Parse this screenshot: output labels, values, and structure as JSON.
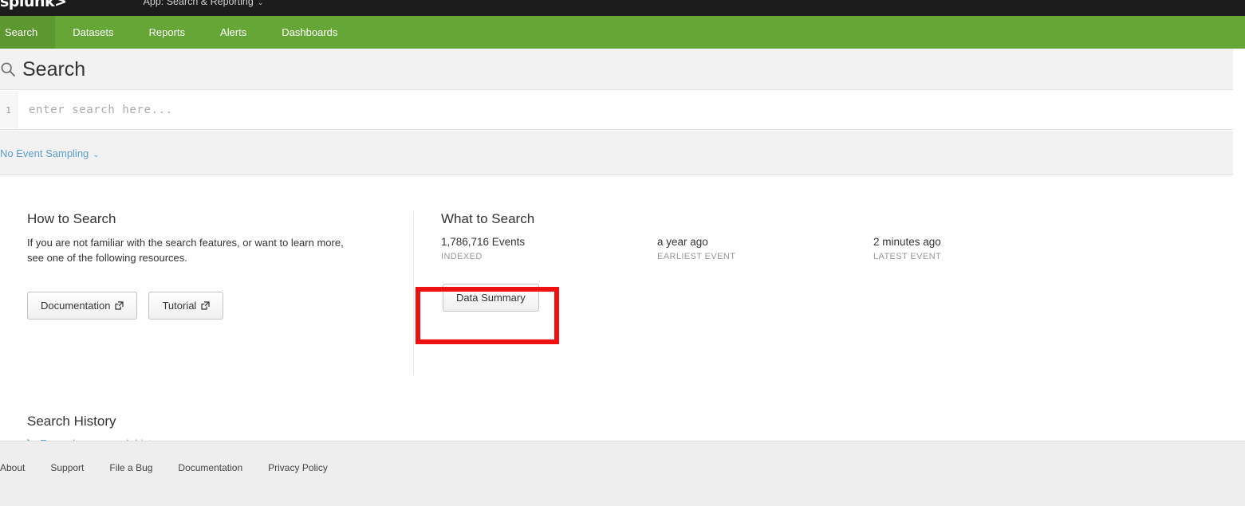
{
  "appbar": {
    "logo": "splunk>",
    "app_context": "App: Search & Reporting",
    "caret": "⌄"
  },
  "nav": {
    "items": [
      {
        "label": "Search",
        "active": true
      },
      {
        "label": "Datasets",
        "active": false
      },
      {
        "label": "Reports",
        "active": false
      },
      {
        "label": "Alerts",
        "active": false
      },
      {
        "label": "Dashboards",
        "active": false
      }
    ]
  },
  "page": {
    "title": "Search",
    "title_icon": "search-icon"
  },
  "search": {
    "line_number": "1",
    "value": "",
    "placeholder": "enter search here..."
  },
  "sampling": {
    "label": "No Event Sampling",
    "caret": "⌄"
  },
  "how_to_search": {
    "heading": "How to Search",
    "description": "If you are not familiar with the search features, or want to learn more, see one of the following resources.",
    "buttons": [
      {
        "label": "Documentation",
        "icon": "external-link-icon"
      },
      {
        "label": "Tutorial",
        "icon": "external-link-icon"
      }
    ]
  },
  "what_to_search": {
    "heading": "What to Search",
    "stats": [
      {
        "value": "1,786,716 Events",
        "label": "INDEXED"
      },
      {
        "value": "a year ago",
        "label": "EARLIEST EVENT"
      },
      {
        "value": "2 minutes ago",
        "label": "LATEST EVENT"
      }
    ],
    "data_summary_button": "Data Summary"
  },
  "search_history": {
    "heading": "Search History",
    "expand_label": "Expand your search history"
  },
  "footer": {
    "links": [
      "About",
      "Support",
      "File a Bug",
      "Documentation",
      "Privacy Policy"
    ]
  },
  "annotation": {
    "color": "#ee1111",
    "target": "data-summary-button"
  },
  "colors": {
    "nav_green": "#65a637",
    "nav_green_active": "#5c9730",
    "appbar_black": "#1c1c1c",
    "link_blue": "#5a9ece",
    "strip_gray": "#f2f2f2",
    "footer_gray": "#eeeeee"
  }
}
